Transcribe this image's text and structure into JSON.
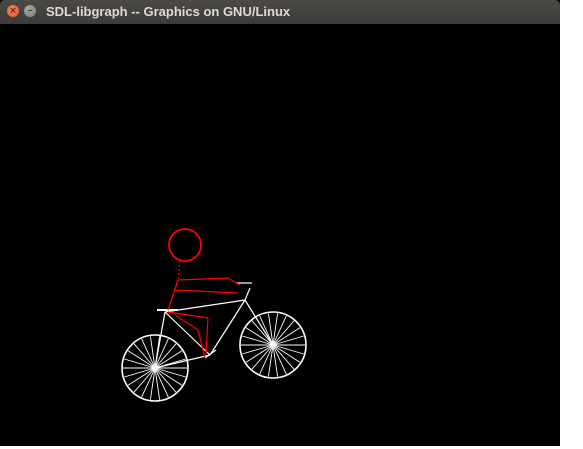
{
  "window": {
    "title": "SDL-libgraph -- Graphics on GNU/Linux",
    "close_glyph": "×",
    "minimize_glyph": "–"
  },
  "colors": {
    "canvas_background": "#000000",
    "bicycle": "#ffffff",
    "rider": "#ff0000",
    "titlebar": "#3c3b37"
  },
  "icons": {
    "close": "close-icon",
    "minimize": "minimize-icon"
  }
}
